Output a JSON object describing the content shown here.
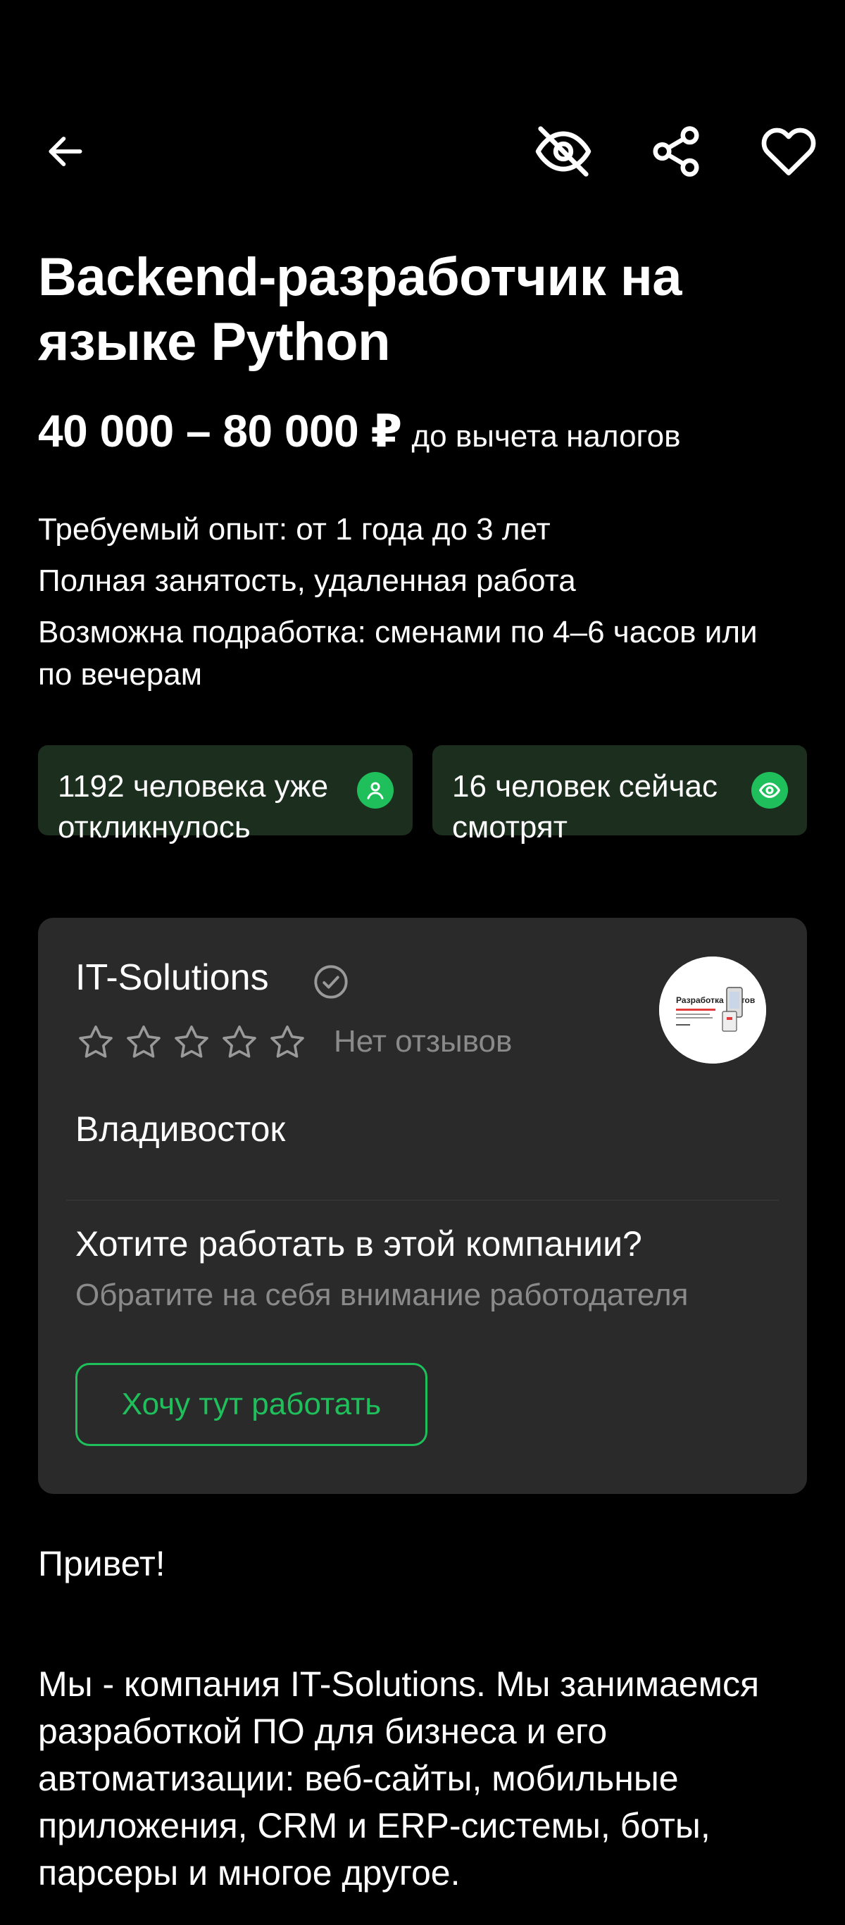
{
  "vacancy": {
    "title": "Backend-разработчик на языке Python",
    "salary": {
      "amount": "40 000 – 80 000 ₽",
      "note": "до вычета налогов"
    },
    "conditions": [
      "Требуемый опыт: от 1 года до 3 лет",
      "Полная занятость, удаленная работа",
      "Возможна подработка: сменами по 4–6 часов или по вечерам"
    ]
  },
  "stats": {
    "responded": "1192 человека уже откликнулось",
    "watching": "16 человек сейчас смотрят"
  },
  "company": {
    "name": "IT-Solutions",
    "rating": 0,
    "max_rating": 5,
    "reviews": "Нет отзывов",
    "city": "Владивосток",
    "question": "Хотите работать в этой компании?",
    "hint": "Обратите на себя внимание работодателя",
    "button": "Хочу тут работать",
    "logo_text": "Разработка сайтов"
  },
  "greeting": "Привет!",
  "description": "Мы - компания IT-Solutions. Мы занимаемся разработкой ПО для бизнеса и его автоматизации: веб-сайты, мобильные приложения, CRM и ERP-системы, боты, парсеры и многое другое.",
  "icons": {
    "back": "arrow-left-icon",
    "hide": "eye-off-icon",
    "share": "share-icon",
    "favorite": "heart-icon",
    "responded": "user-icon",
    "watching": "eye-icon",
    "verified": "check-circle-icon",
    "star": "star-outline-icon"
  },
  "colors": {
    "background": "#000000",
    "card": "#2a2a2a",
    "stat_card": "#1c2f1f",
    "accent": "#1fbf5c",
    "muted": "#8a8a8a"
  }
}
